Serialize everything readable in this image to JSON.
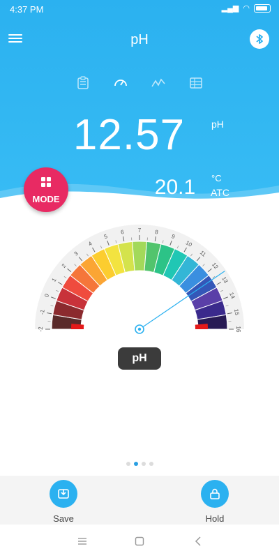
{
  "status_bar": {
    "time": "4:37 PM",
    "battery_icon": "battery-icon"
  },
  "header": {
    "title": "pH",
    "menu_icon": "menu-icon",
    "bluetooth_icon": "bluetooth-icon"
  },
  "tabs": [
    {
      "name": "clipboard-icon"
    },
    {
      "name": "gauge-icon",
      "active": true
    },
    {
      "name": "trend-icon"
    },
    {
      "name": "table-icon"
    }
  ],
  "reading": {
    "value": "12.57",
    "unit": "pH"
  },
  "temperature": {
    "value": "20.1",
    "unit": "°C",
    "mode": "ATC"
  },
  "mode_button": {
    "label": "MODE"
  },
  "gauge": {
    "ticks": [
      "-2",
      "-1",
      "0",
      "1",
      "2",
      "3",
      "4",
      "5",
      "6",
      "7",
      "8",
      "9",
      "10",
      "11",
      "12",
      "13",
      "14",
      "15",
      "16"
    ],
    "scale_min": -2,
    "scale_max": 16,
    "needle_value": 12.57,
    "label": "pH"
  },
  "pager": {
    "count": 4,
    "active_index": 1
  },
  "actions": {
    "save_label": "Save",
    "hold_label": "Hold"
  },
  "colors": {
    "accent": "#2bb1f0",
    "mode": "#e82a63",
    "active_dot": "#2a9fe2"
  }
}
